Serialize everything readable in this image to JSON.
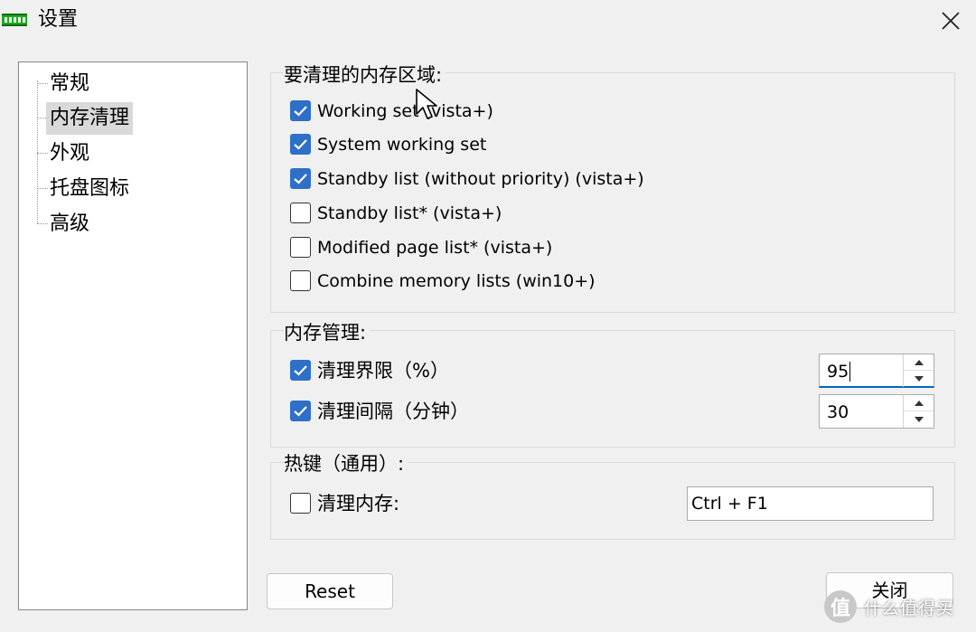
{
  "window": {
    "title": "设置",
    "icon": "memory-chip-icon",
    "close_icon": "close-icon"
  },
  "sidebar": {
    "items": [
      {
        "label": "常规",
        "selected": false
      },
      {
        "label": "内存清理",
        "selected": true
      },
      {
        "label": "外观",
        "selected": false
      },
      {
        "label": "托盘图标",
        "selected": false
      },
      {
        "label": "高级",
        "selected": false
      }
    ]
  },
  "regions_group": {
    "title": "要清理的内存区域:",
    "options": [
      {
        "label": "Working set (vista+)",
        "checked": true
      },
      {
        "label": "System working set",
        "checked": true
      },
      {
        "label": "Standby list (without priority) (vista+)",
        "checked": true
      },
      {
        "label": "Standby list* (vista+)",
        "checked": false
      },
      {
        "label": "Modified page list* (vista+)",
        "checked": false
      },
      {
        "label": "Combine memory lists (win10+)",
        "checked": false
      }
    ]
  },
  "management_group": {
    "title": "内存管理:",
    "threshold": {
      "label": "清理界限（%）",
      "checked": true,
      "value": "95"
    },
    "interval": {
      "label": "清理间隔（分钟）",
      "checked": true,
      "value": "30"
    }
  },
  "hotkey_group": {
    "title": "热键（通用）:",
    "clean": {
      "label": "清理内存:",
      "checked": false,
      "value": "Ctrl + F1"
    }
  },
  "buttons": {
    "reset": "Reset",
    "close": "关闭"
  },
  "watermark": {
    "logo": "值",
    "text": "什么值得买"
  },
  "colors": {
    "accent": "#2e6fc8",
    "background": "#f0f0f0",
    "focus_underline": "#0067c0"
  }
}
